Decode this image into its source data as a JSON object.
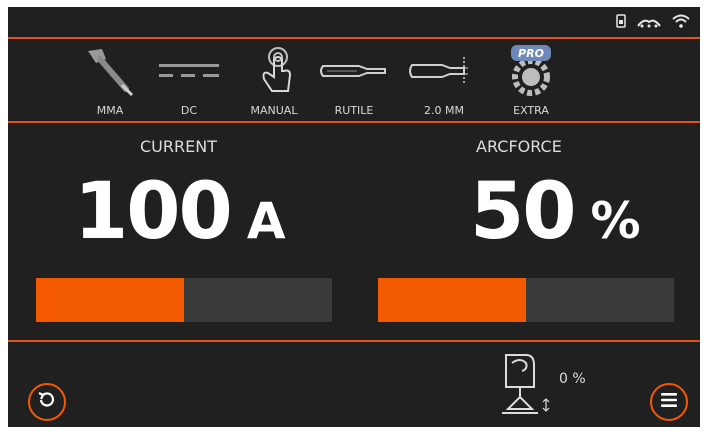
{
  "status": {
    "icons": [
      "sim-card-icon",
      "wifi-dots-icon",
      "wifi-icon"
    ]
  },
  "modes": [
    {
      "label": "MMA",
      "icon": "electrode-holder-icon"
    },
    {
      "label": "DC",
      "icon": "dc-current-icon"
    },
    {
      "label": "MANUAL",
      "icon": "touch-hand-icon"
    },
    {
      "label": "RUTILE",
      "icon": "rutile-electrode-icon"
    },
    {
      "label": "2.0 MM",
      "icon": "electrode-diameter-icon"
    },
    {
      "label": "EXTRA",
      "icon": "pro-gear-icon",
      "badge": "PRO"
    }
  ],
  "current": {
    "title": "CURRENT",
    "value": "100",
    "unit": "A",
    "bar_fraction": 0.5
  },
  "arcforce": {
    "title": "ARCFORCE",
    "value": "50",
    "unit": "%",
    "bar_fraction": 0.5
  },
  "wire": {
    "value": "0 %",
    "icon": "wire-feed-icon"
  },
  "buttons": {
    "reset_icon": "reset-icon",
    "menu_icon": "menu-icon"
  },
  "colors": {
    "accent": "#f35a00",
    "divider": "#e2541b",
    "background": "#202020",
    "bar_track": "#3a3a3a"
  }
}
